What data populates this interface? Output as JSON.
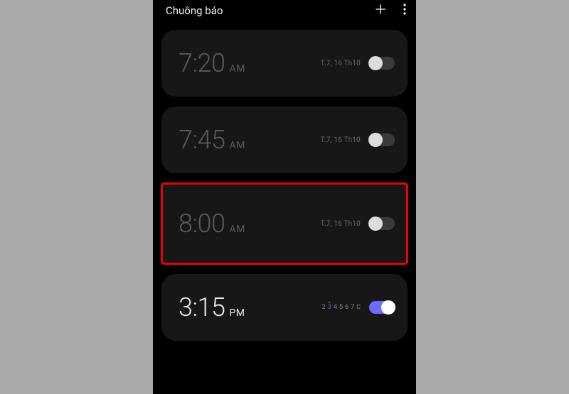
{
  "header": {
    "title": "Chuông báo"
  },
  "alarms": [
    {
      "time": "7:20",
      "period": "AM",
      "repeat_label": "T.7, 16 Th10",
      "enabled": false,
      "highlighted": false
    },
    {
      "time": "7:45",
      "period": "AM",
      "repeat_label": "T.7, 16 Th10",
      "enabled": false,
      "highlighted": false
    },
    {
      "time": "8:00",
      "period": "AM",
      "repeat_label": "T.7, 16 Th10",
      "enabled": false,
      "highlighted": true
    },
    {
      "time": "3:15",
      "period": "PM",
      "days": [
        "2",
        "3",
        "4",
        "5",
        "6",
        "7",
        "C"
      ],
      "selected_day_index": 1,
      "enabled": true,
      "highlighted": false
    }
  ]
}
